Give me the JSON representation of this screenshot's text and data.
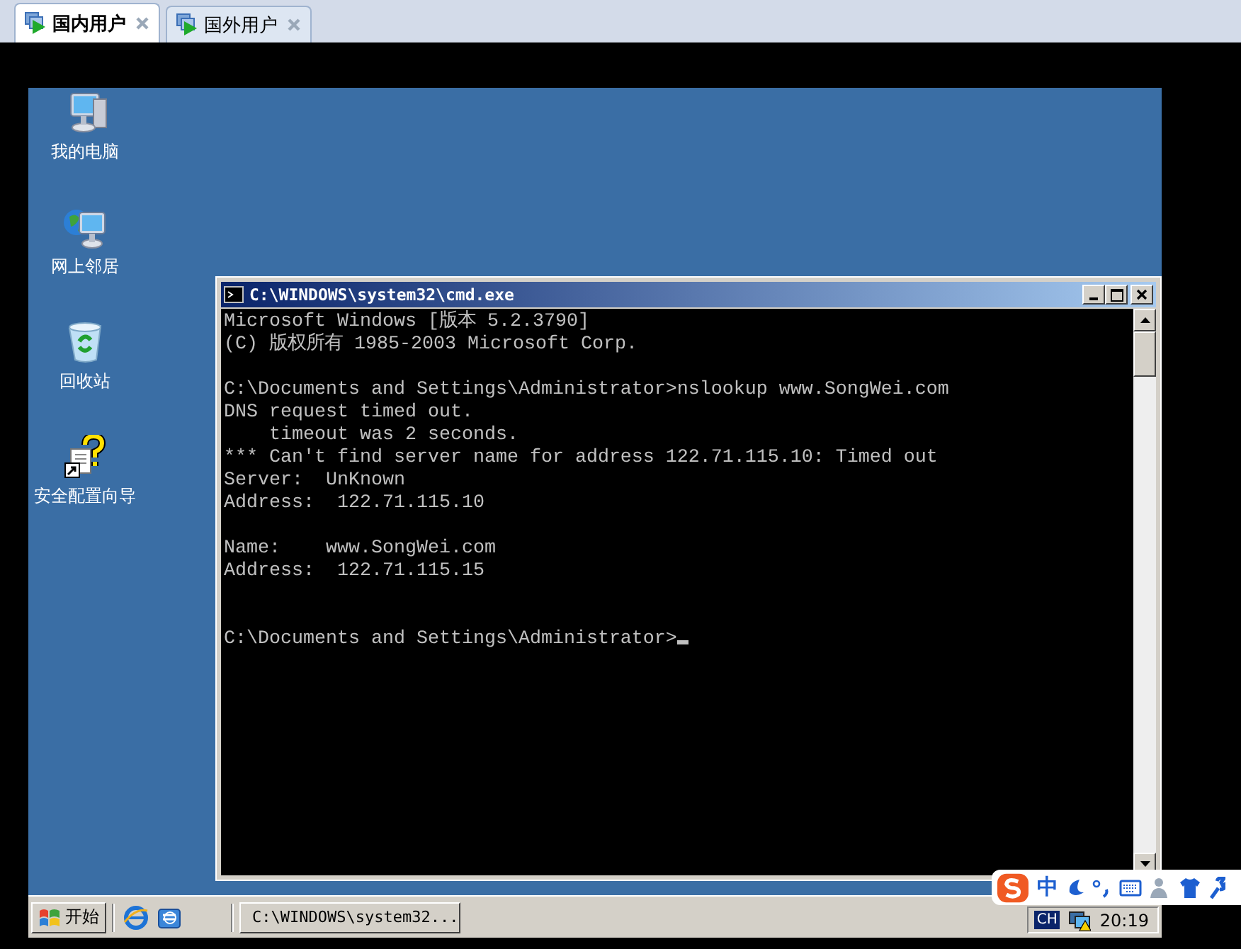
{
  "tabs": [
    {
      "label": "国内用户",
      "selected": true
    },
    {
      "label": "国外用户",
      "selected": false
    }
  ],
  "desktop_icons": [
    {
      "kind": "computer",
      "label": "我的电脑"
    },
    {
      "kind": "network",
      "label": "网上邻居"
    },
    {
      "kind": "recycle",
      "label": "回收站"
    },
    {
      "kind": "wizard",
      "label": "安全配置向导"
    }
  ],
  "console": {
    "title": "C:\\WINDOWS\\system32\\cmd.exe",
    "blocks": [
      {
        "kind": "output",
        "lines": [
          "Microsoft Windows [版本 5.2.3790]",
          "(C) 版权所有 1985-2003 Microsoft Corp."
        ]
      },
      {
        "kind": "output",
        "lines": [
          "C:\\Documents and Settings\\Administrator>nslookup www.SongWei.com",
          "DNS request timed out.",
          "    timeout was 2 seconds.",
          "*** Can't find server name for address 122.71.115.10: Timed out",
          "Server:  UnKnown",
          "Address:  122.71.115.10"
        ]
      },
      {
        "kind": "output",
        "lines": [
          "Name:    www.SongWei.com",
          "Address:  122.71.115.15"
        ]
      },
      {
        "kind": "prompt",
        "lines": [
          "C:\\Documents and Settings\\Administrator>"
        ]
      }
    ]
  },
  "taskbar": {
    "start": "开始",
    "tasks": [
      {
        "label": "C:\\WINDOWS\\system32...",
        "selected": false
      }
    ],
    "language": "CH",
    "clock": "20:19"
  },
  "ime_bar": {
    "mode": "中"
  }
}
